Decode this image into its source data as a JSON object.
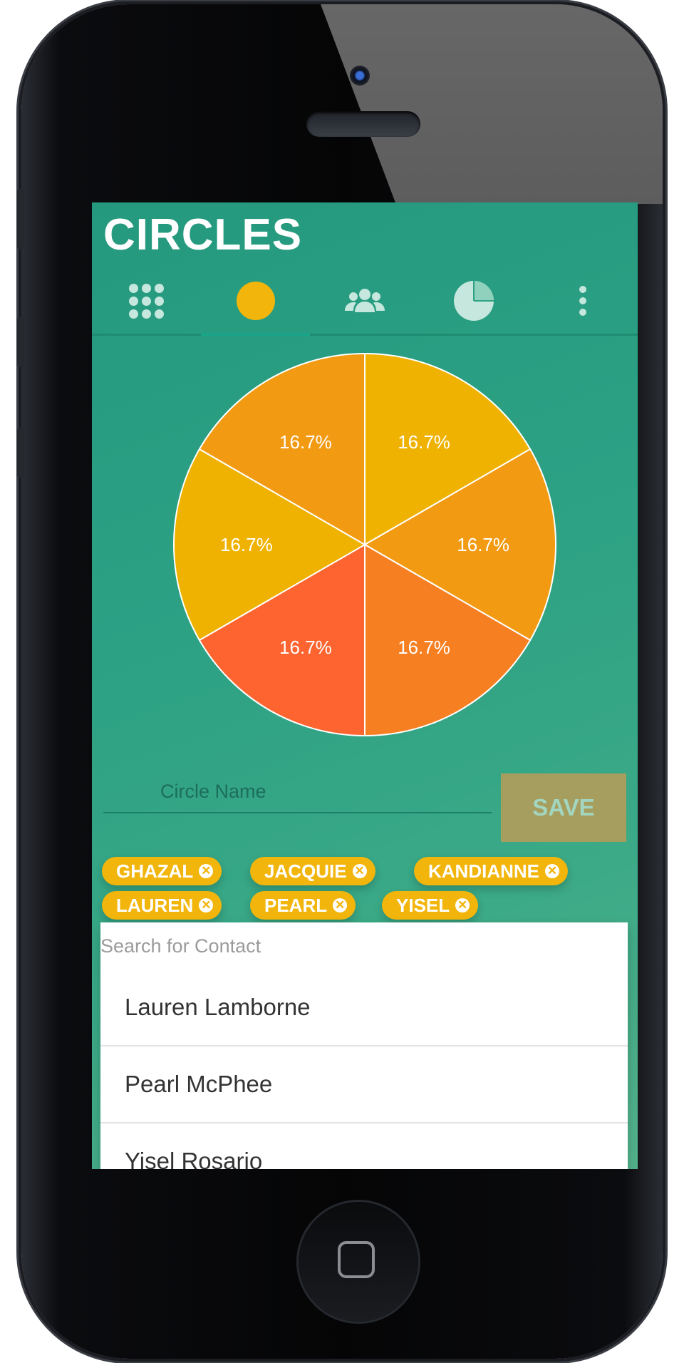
{
  "app": {
    "title": "CIRCLES"
  },
  "tabs": [
    {
      "name": "grid",
      "icon": "grid-icon"
    },
    {
      "name": "circle",
      "icon": "circle-icon",
      "active": true
    },
    {
      "name": "people",
      "icon": "people-icon"
    },
    {
      "name": "chart",
      "icon": "pie-chart-icon"
    },
    {
      "name": "more",
      "icon": "more-vert-icon"
    }
  ],
  "chart_data": {
    "type": "pie",
    "labels": [
      "16.7%",
      "16.7%",
      "16.7%",
      "16.7%",
      "16.7%",
      "16.7%"
    ],
    "values": [
      16.7,
      16.7,
      16.7,
      16.7,
      16.7,
      16.7
    ],
    "colors": [
      "#efb200",
      "#f19a12",
      "#f67f22",
      "#fd6430",
      "#efb200",
      "#f19a12"
    ]
  },
  "form": {
    "name_placeholder": "Circle Name",
    "save_label": "SAVE"
  },
  "chips": [
    "GHAZAL",
    "JACQUIE",
    "KANDIANNE",
    "LAUREN",
    "PEARL",
    "YISEL"
  ],
  "contacts": {
    "search_placeholder": "Search for Contact",
    "items": [
      "Lauren Lamborne",
      "Pearl McPhee",
      "Yisel Rosario"
    ]
  },
  "colors": {
    "accent": "#f2b50c",
    "background": "#2ca184",
    "save_button": "#a69e5e"
  }
}
